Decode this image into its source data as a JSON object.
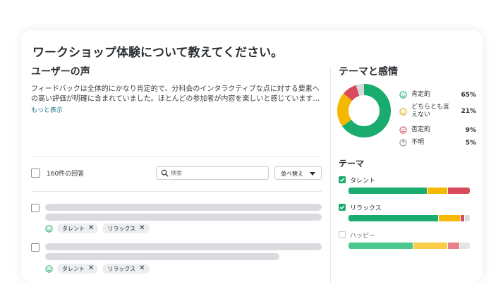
{
  "title": "ワークショップ体験について教えてください。",
  "voice": {
    "heading": "ユーザーの声",
    "summary_line1": "フィードバックは全体的にかなり肯定的で、分科会のインタラクティブな点に対する要素へ",
    "summary_line2": "の高い評価が明確に含まれていました。ほとんどの参加者が内容を楽しいと感じています…",
    "more_link": "もっと表示"
  },
  "toolbar": {
    "count_label": "160件の回答",
    "search_placeholder": "検索",
    "sort_label": "並べ替え"
  },
  "responses": [
    {
      "tags": [
        "タレント",
        "リラックス"
      ]
    },
    {
      "tags": [
        "タレント",
        "リラックス"
      ]
    },
    {
      "tags": []
    }
  ],
  "sentiment": {
    "heading": "テーマと感情",
    "items": [
      {
        "label": "肯定的",
        "pct": "65%",
        "value": 65,
        "color": "#1aab6e",
        "icon": "smile-icon"
      },
      {
        "label": "どちらとも言えない",
        "pct": "21%",
        "value": 21,
        "color": "#f5b800",
        "icon": "neutral-face-icon"
      },
      {
        "label": "否定的",
        "pct": "9%",
        "value": 9,
        "color": "#d94a5a",
        "icon": "frown-icon"
      },
      {
        "label": "不明",
        "pct": "5%",
        "value": 5,
        "color": "#d8dadd",
        "icon": "question-icon"
      }
    ]
  },
  "themes": {
    "heading": "テーマ",
    "items": [
      {
        "label": "タレント",
        "checked": true,
        "segments": [
          {
            "value": 65,
            "color": "#1aab6e"
          },
          {
            "value": 17,
            "color": "#f5b800"
          },
          {
            "value": 18,
            "color": "#d94a5a"
          }
        ]
      },
      {
        "label": "リラックス",
        "checked": true,
        "segments": [
          {
            "value": 75,
            "color": "#1aab6e"
          },
          {
            "value": 18,
            "color": "#f5b800"
          },
          {
            "value": 3,
            "color": "#d94a5a"
          },
          {
            "value": 4,
            "color": "#d8dadd"
          }
        ]
      },
      {
        "label": "ハッピー",
        "checked": false,
        "segments": [
          {
            "value": 54,
            "color": "#4cc88f"
          },
          {
            "value": 28,
            "color": "#f9cd4a"
          },
          {
            "value": 10,
            "color": "#e9808c"
          },
          {
            "value": 8,
            "color": "#e2e4e6"
          }
        ]
      }
    ]
  }
}
